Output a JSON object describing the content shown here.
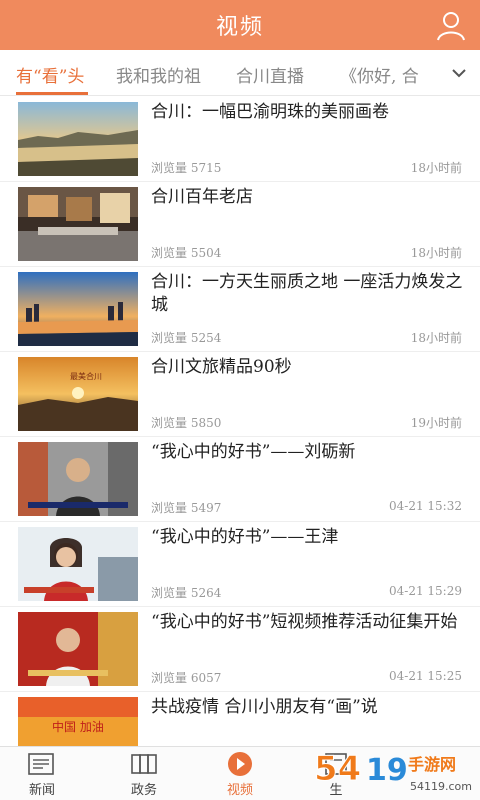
{
  "header": {
    "title": "视频"
  },
  "tabs": [
    {
      "label": "有“看”头",
      "active": true
    },
    {
      "label": "我和我的祖",
      "active": false
    },
    {
      "label": "合川直播",
      "active": false
    },
    {
      "label": "《你好, 合",
      "active": false
    }
  ],
  "items": [
    {
      "title": "合川：一幅巴渝明珠的美丽画卷",
      "views": "浏览量 5715",
      "time": "18小时前"
    },
    {
      "title": "合川百年老店",
      "views": "浏览量 5504",
      "time": "18小时前"
    },
    {
      "title": "合川：一方天生丽质之地 一座活力焕发之城",
      "views": "浏览量 5254",
      "time": "18小时前"
    },
    {
      "title": "合川文旅精品90秒",
      "views": "浏览量 5850",
      "time": "19小时前",
      "thumb_caption": "最美合川"
    },
    {
      "title": "“我心中的好书”——刘砺新",
      "views": "浏览量 5497",
      "time": "04-21 15:32"
    },
    {
      "title": "“我心中的好书”——王津",
      "views": "浏览量 5264",
      "time": "04-21 15:29"
    },
    {
      "title": "“我心中的好书”短视频推荐活动征集开始",
      "views": "浏览量 6057",
      "time": "04-21 15:25"
    },
    {
      "title": "共战疫情 合川小朋友有“画”说",
      "views": "",
      "time": "",
      "thumb_caption": "中国 加油"
    }
  ],
  "bottom_nav": [
    {
      "label": "新闻",
      "icon": "newspaper-icon"
    },
    {
      "label": "政务",
      "icon": "government-icon"
    },
    {
      "label": "视频",
      "icon": "play-icon",
      "active": true
    },
    {
      "label": "生",
      "icon": "life-icon"
    }
  ],
  "watermark": {
    "text": "5419手游网",
    "sub": "54119.com"
  },
  "colors": {
    "accent": "#f08a5d",
    "active_tab": "#e8703a"
  }
}
